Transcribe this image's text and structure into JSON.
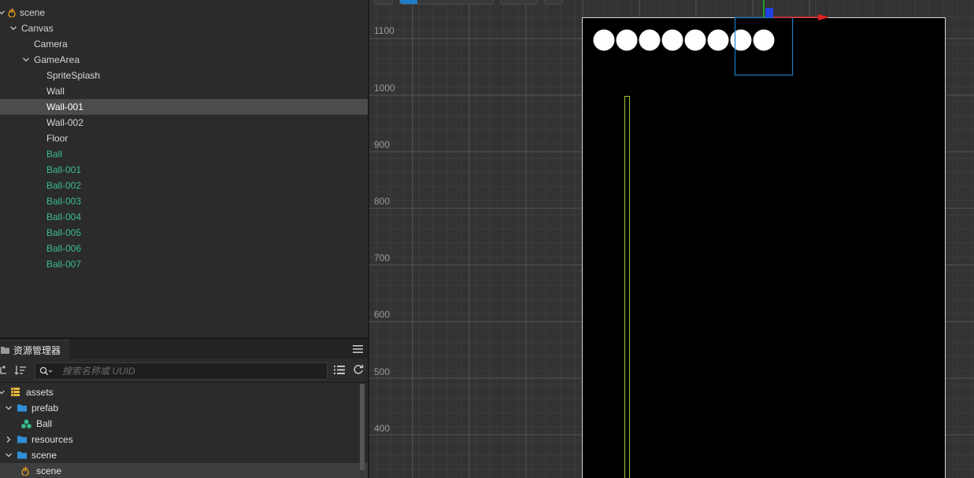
{
  "hierarchy": {
    "nodes": [
      {
        "label": "scene",
        "depth": 0,
        "expanded": true,
        "icon": "scene-icon",
        "type": "scene",
        "selected": false
      },
      {
        "label": "Canvas",
        "depth": 1,
        "expanded": true,
        "type": "node",
        "selected": false
      },
      {
        "label": "Camera",
        "depth": 2,
        "type": "node",
        "selected": false
      },
      {
        "label": "GameArea",
        "depth": 2,
        "expanded": true,
        "type": "node",
        "selected": false
      },
      {
        "label": "SpriteSplash",
        "depth": 3,
        "type": "node",
        "selected": false
      },
      {
        "label": "Wall",
        "depth": 3,
        "type": "node",
        "selected": false
      },
      {
        "label": "Wall-001",
        "depth": 3,
        "type": "node",
        "selected": true
      },
      {
        "label": "Wall-002",
        "depth": 3,
        "type": "node",
        "selected": false
      },
      {
        "label": "Floor",
        "depth": 3,
        "type": "node",
        "selected": false
      },
      {
        "label": "Ball",
        "depth": 3,
        "type": "prefab",
        "selected": false
      },
      {
        "label": "Ball-001",
        "depth": 3,
        "type": "prefab",
        "selected": false
      },
      {
        "label": "Ball-002",
        "depth": 3,
        "type": "prefab",
        "selected": false
      },
      {
        "label": "Ball-003",
        "depth": 3,
        "type": "prefab",
        "selected": false
      },
      {
        "label": "Ball-004",
        "depth": 3,
        "type": "prefab",
        "selected": false
      },
      {
        "label": "Ball-005",
        "depth": 3,
        "type": "prefab",
        "selected": false
      },
      {
        "label": "Ball-006",
        "depth": 3,
        "type": "prefab",
        "selected": false
      },
      {
        "label": "Ball-007",
        "depth": 3,
        "type": "prefab",
        "selected": false
      }
    ]
  },
  "assets": {
    "tab_title": "资源管理器",
    "search_placeholder": "搜索名称或 UUID",
    "items": [
      {
        "label": "assets",
        "depth": 0,
        "expanded": true,
        "icon": "database-icon"
      },
      {
        "label": "prefab",
        "depth": 1,
        "expanded": true,
        "icon": "folder-icon"
      },
      {
        "label": "Ball",
        "depth": 2,
        "icon": "prefab-icon"
      },
      {
        "label": "resources",
        "depth": 1,
        "expanded": false,
        "icon": "folder-icon"
      },
      {
        "label": "scene",
        "depth": 1,
        "expanded": true,
        "icon": "folder-icon"
      },
      {
        "label": "scene",
        "depth": 2,
        "icon": "scene-icon",
        "selected": true
      }
    ]
  },
  "scene_view": {
    "y_axis_labels": [
      "1100",
      "1000",
      "900",
      "800",
      "700",
      "600",
      "500",
      "400"
    ],
    "ball_count": 8,
    "colors": {
      "background": "#333333",
      "canvas": "#000000",
      "grid": "#4a4a4a",
      "selection": "#1e7ec8",
      "wall": "#9acd32",
      "ball": "#ffffff",
      "axis_x": "#e02020",
      "axis_y": "#20c020",
      "axis_z": "#2040e0"
    }
  }
}
